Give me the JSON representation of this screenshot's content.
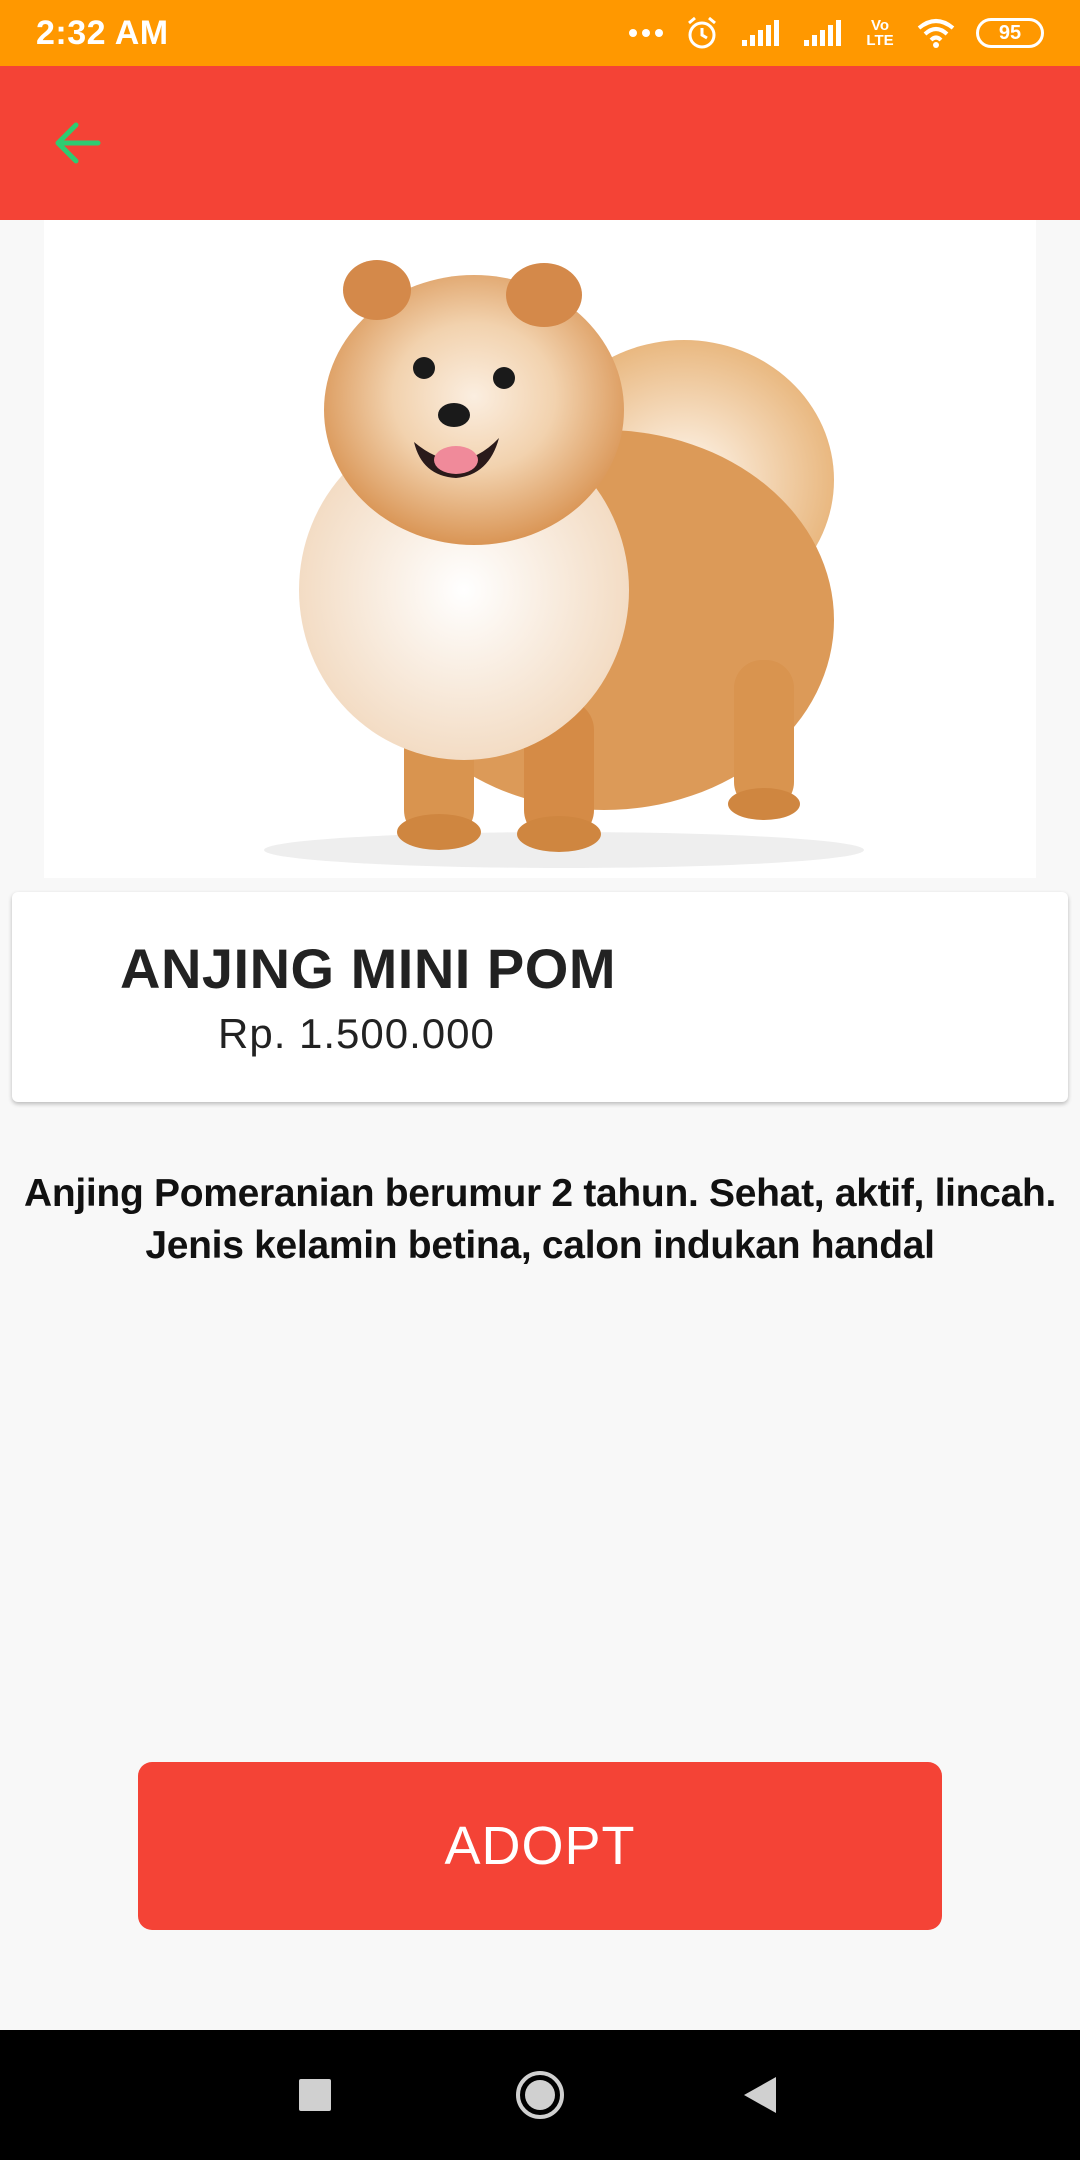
{
  "status_bar": {
    "time": "2:32 AM",
    "network_label": "Vo LTE",
    "battery": "95",
    "icons": [
      "more-icon",
      "alarm-icon",
      "signal-icon",
      "signal-icon",
      "volte-icon",
      "wifi-icon",
      "battery-icon"
    ]
  },
  "app_bar": {
    "back_icon": "back-arrow-icon",
    "color": "#f44336"
  },
  "pet": {
    "image_subject": "pomeranian-dog",
    "name": "ANJING MINI POM",
    "price": "Rp. 1.500.000",
    "description": "Anjing Pomeranian berumur 2 tahun. Sehat, aktif, lincah. Jenis kelamin betina, calon indukan handal"
  },
  "actions": {
    "adopt_label": "ADOPT"
  },
  "nav_bar": {
    "icons": [
      "recents-icon",
      "home-icon",
      "back-icon"
    ]
  },
  "colors": {
    "status_bar": "#ff9800",
    "accent": "#f44336",
    "back_arrow": "#2ecc71"
  }
}
